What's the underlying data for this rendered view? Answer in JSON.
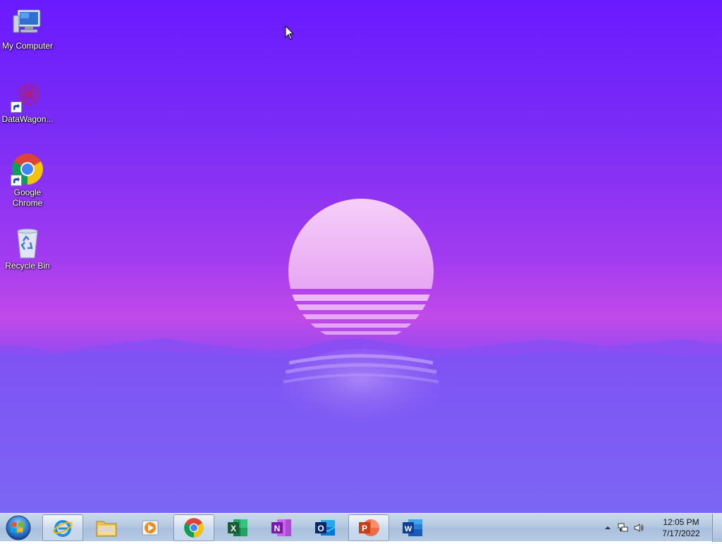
{
  "desktop": {
    "icons": [
      {
        "label": "My Computer",
        "icon": "computer-icon"
      },
      {
        "label": "DataWagon...",
        "icon": "datawagon-icon"
      },
      {
        "label": "Google\nChrome",
        "label_line1": "Google",
        "label_line2": "Chrome",
        "icon": "chrome-icon"
      },
      {
        "label": "Recycle Bin",
        "icon": "recycle-bin-icon"
      }
    ]
  },
  "taskbar": {
    "start": {
      "icon": "windows-start-orb-icon"
    },
    "pinned": [
      {
        "name": "internet-explorer",
        "icon": "internet-explorer-icon",
        "active": true
      },
      {
        "name": "file-explorer",
        "icon": "folder-icon",
        "active": false
      },
      {
        "name": "media-player",
        "icon": "media-player-icon",
        "active": false
      },
      {
        "name": "google-chrome",
        "icon": "chrome-icon",
        "active": true
      },
      {
        "name": "excel",
        "icon": "excel-icon",
        "letter": "X",
        "active": false
      },
      {
        "name": "onenote",
        "icon": "onenote-icon",
        "letter": "N",
        "active": false
      },
      {
        "name": "outlook",
        "icon": "outlook-icon",
        "letter": "O",
        "active": false
      },
      {
        "name": "powerpoint",
        "icon": "powerpoint-icon",
        "letter": "P",
        "active": true
      },
      {
        "name": "word",
        "icon": "word-icon",
        "letter": "W",
        "active": false
      }
    ],
    "tray": {
      "icons": [
        "show-hidden-icons-chevron-icon",
        "network-icon",
        "volume-icon"
      ],
      "time": "12:05 PM",
      "date": "7/17/2022"
    }
  },
  "colors": {
    "excel": "#1d7a44",
    "onenote": "#7a2b9e",
    "outlook": "#0a64c2",
    "powerpoint": "#d04a26",
    "word": "#1f5bbf"
  }
}
